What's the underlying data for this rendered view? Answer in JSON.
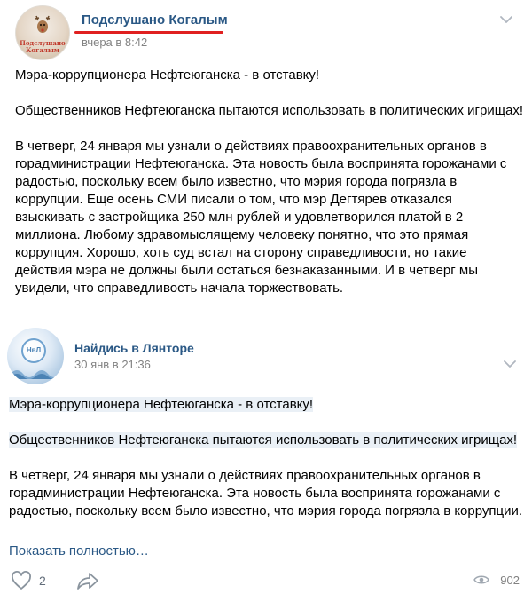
{
  "post": {
    "author": "Подслушано Когалым",
    "avatar_text": "Подслушано Когалым",
    "time": "вчера в 8:42",
    "paragraphs": [
      "Мэра-коррупционера Нефтеюганска - в отставку!",
      "Общественников Нефтеюганска пытаются использовать в политических игрищах!",
      "В четверг, 24 января мы узнали о действиях правоохранительных органов в горадминистрации Нефтеюганска. Эта новость была воспринята горожанами с радостью, поскольку всем было известно, что мэрия города погрязла в коррупции. Еще осень СМИ писали о том, что мэр Дегтярев отказался взыскивать с застройщика 250 млн рублей и удовлетворился платой в 2 миллиона. Любому здравомыслящему человеку понятно, что это прямая коррупция. Хорошо, хоть суд встал на сторону справедливости, но такие действия мэра не должны были остаться безнаказанными. И в четверг мы увидели, что справедливость начала торжествовать."
    ]
  },
  "repost": {
    "author": "Найдись в Лянторе",
    "avatar_text": "НвЛ",
    "time": "30 янв в 21:36",
    "paragraphs": [
      "Мэра-коррупционера Нефтеюганска - в отставку!",
      "Общественников Нефтеюганска пытаются использовать в политических игрищах!",
      "В четверг, 24 января мы узнали о действиях правоохранительных органов в горадминистрации Нефтеюганска. Эта новость была воспринята горожанами с радостью, поскольку всем было известно, что мэрия города погрязла в коррупции."
    ],
    "show_more": "Показать полностью…"
  },
  "footer": {
    "likes": "2",
    "views": "902",
    "icons": [
      "heart-icon",
      "share-arrow-icon",
      "eye-icon"
    ]
  },
  "colors": {
    "link": "#2a5885",
    "meta": "#828282",
    "underline": "#e02020",
    "highlight": "#eaf0f6"
  }
}
